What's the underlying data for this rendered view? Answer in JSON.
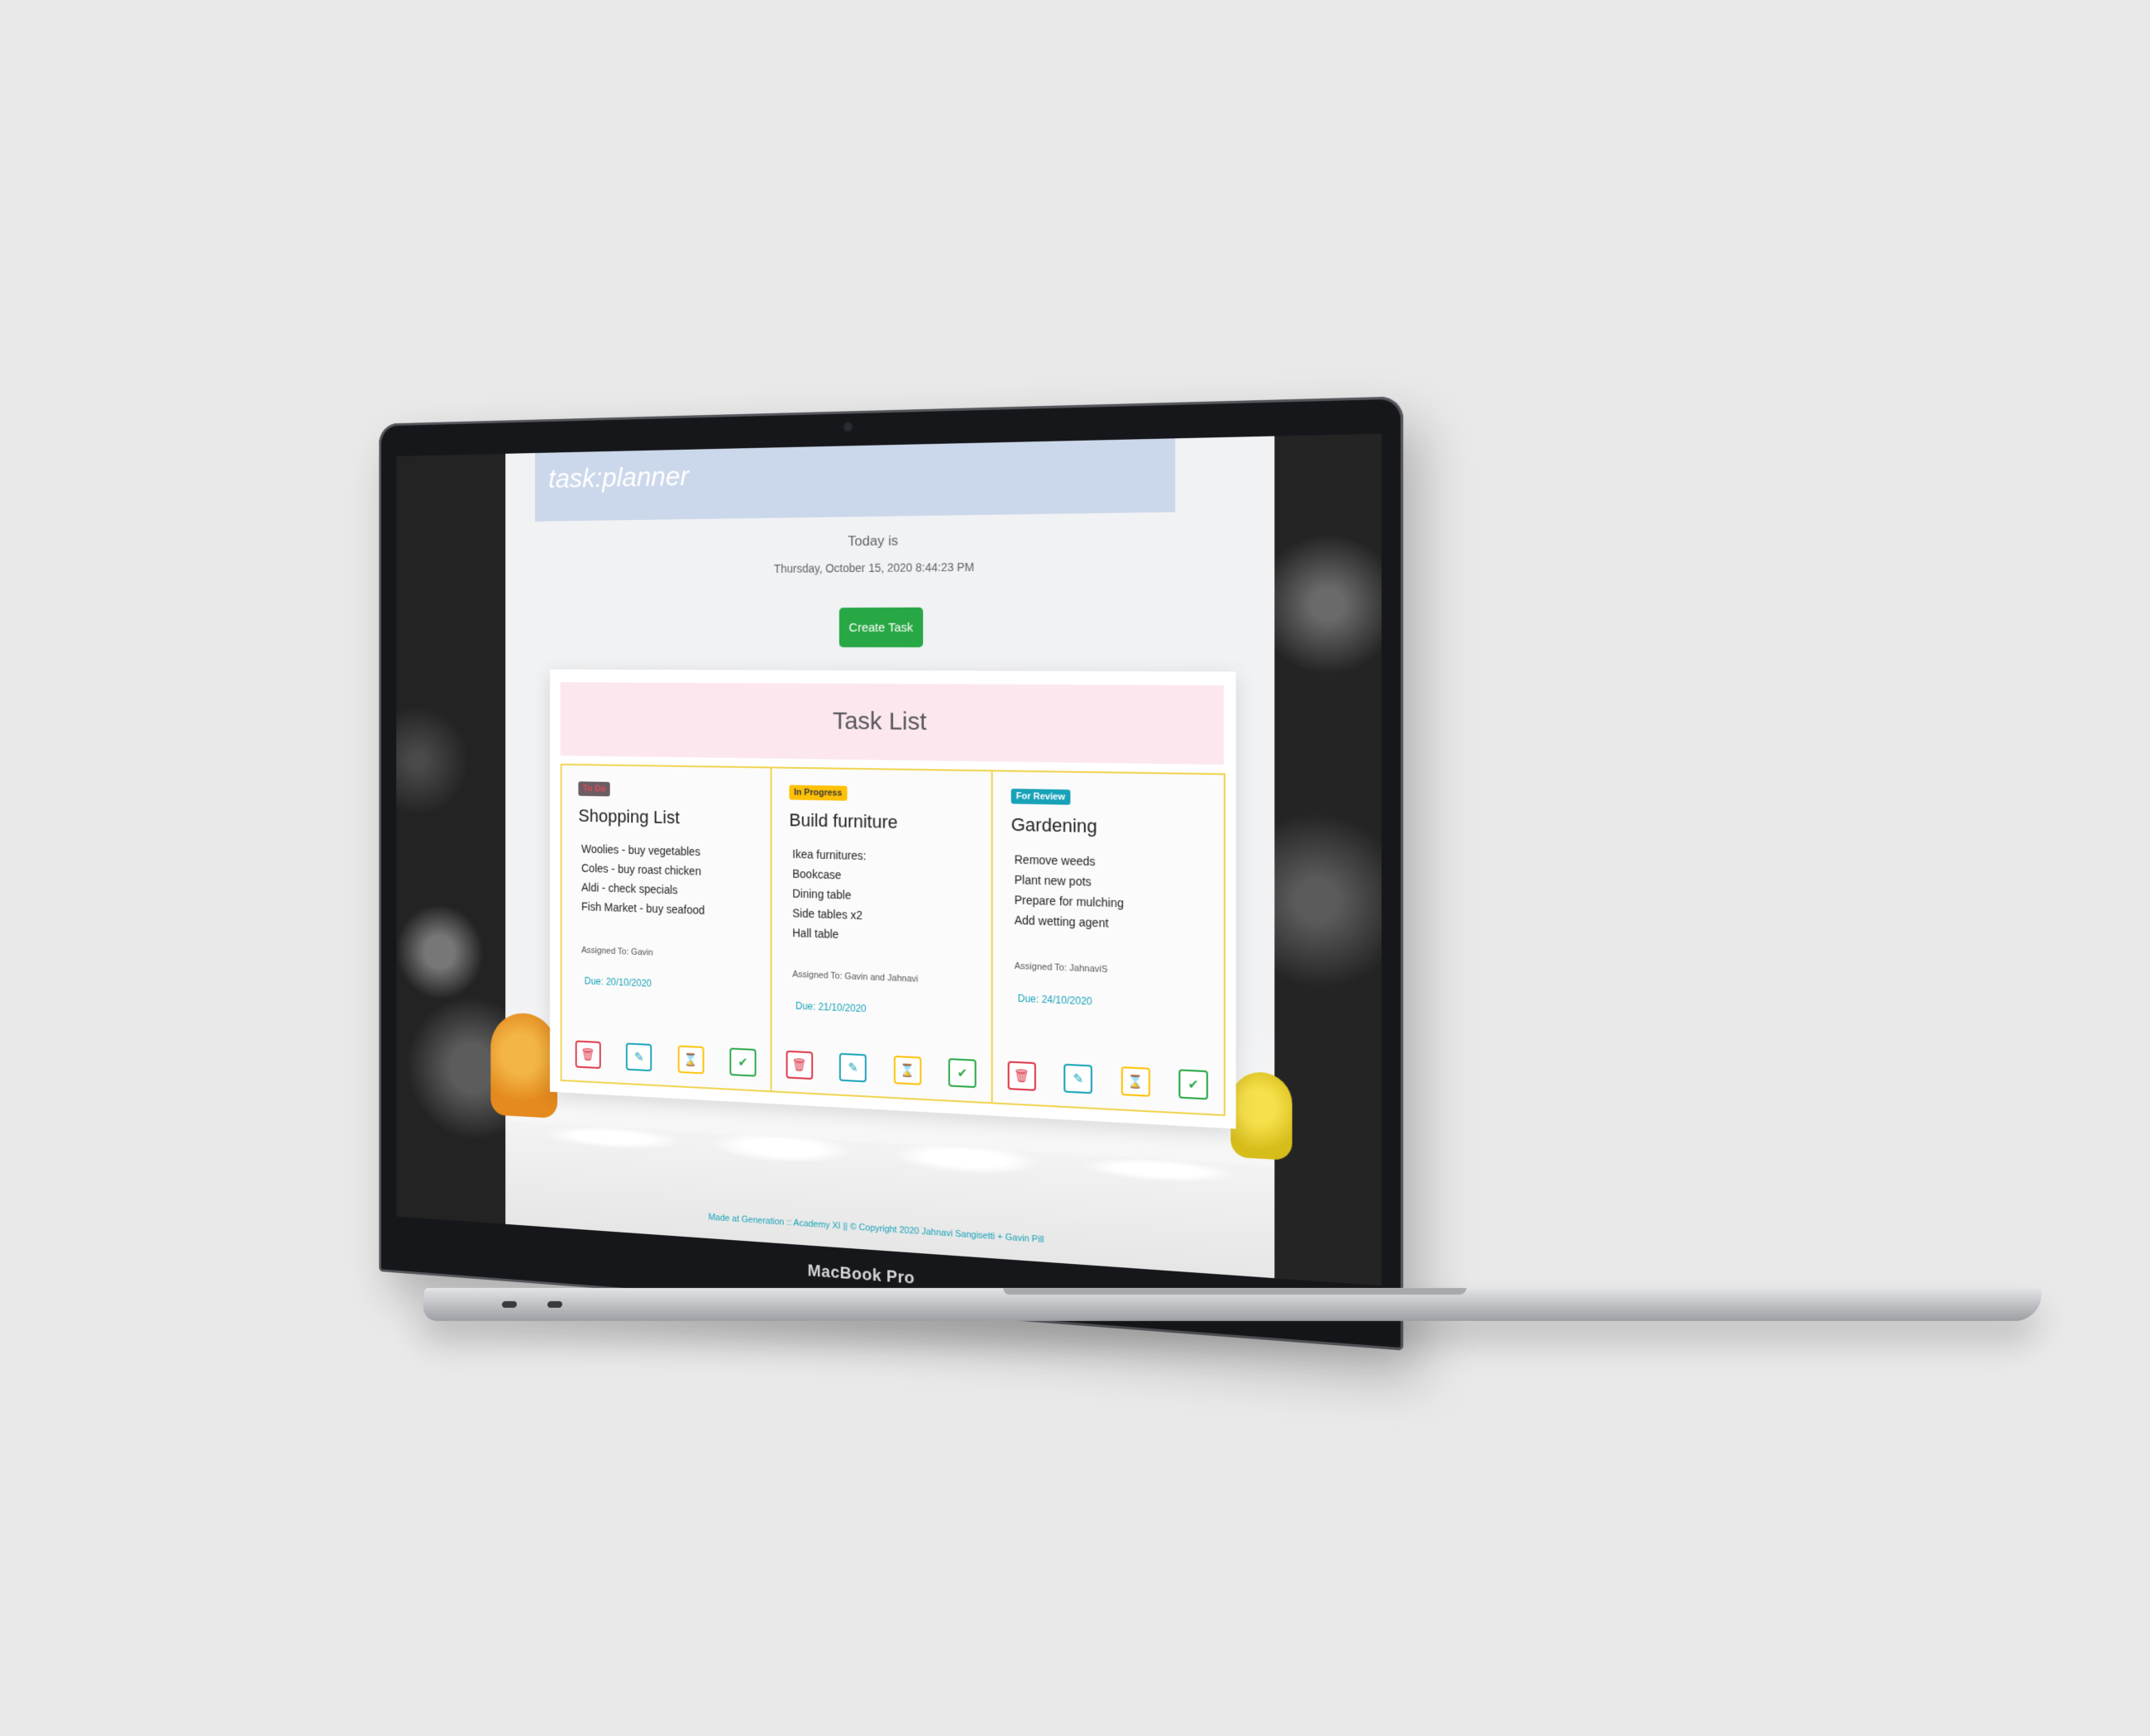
{
  "device": {
    "label": "MacBook Pro"
  },
  "app": {
    "brand": "task:planner",
    "today_label": "Today is",
    "today_date": "Thursday, October 15, 2020 8:44:23 PM",
    "create_button": "Create Task",
    "panel_title": "Task List",
    "footer": "Made at Generation :: Academy XI || © Copyright 2020 Jahnavi Sangisetti + Gavin Pill"
  },
  "tasks": [
    {
      "status": "To Do",
      "title": "Shopping List",
      "items": [
        "Woolies - buy vegetables",
        "Coles - buy roast chicken",
        "Aldi - check specials",
        "Fish Market - buy seafood"
      ],
      "assigned": "Assigned To: Gavin",
      "due": "Due: 20/10/2020"
    },
    {
      "status": "In Progress",
      "title": "Build furniture",
      "items": [
        "Ikea furnitures:",
        "Bookcase",
        "Dining table",
        "Side tables x2",
        "Hall table"
      ],
      "assigned": "Assigned To: Gavin and Jahnavi",
      "due": "Due: 21/10/2020"
    },
    {
      "status": "For Review",
      "title": "Gardening",
      "items": [
        "Remove weeds",
        "Plant new pots",
        "Prepare for mulching",
        "Add wetting agent"
      ],
      "assigned": "Assigned To: JahnaviS",
      "due": "Due: 24/10/2020"
    }
  ],
  "icons": {
    "delete": "trash-icon",
    "edit": "edit-icon",
    "in_progress": "hourglass-icon",
    "done": "check-icon"
  },
  "colors": {
    "navbar": "#cbd7ea",
    "panel_header": "#fde7ee",
    "card_border": "#f0d34d",
    "create_button": "#28a745"
  }
}
